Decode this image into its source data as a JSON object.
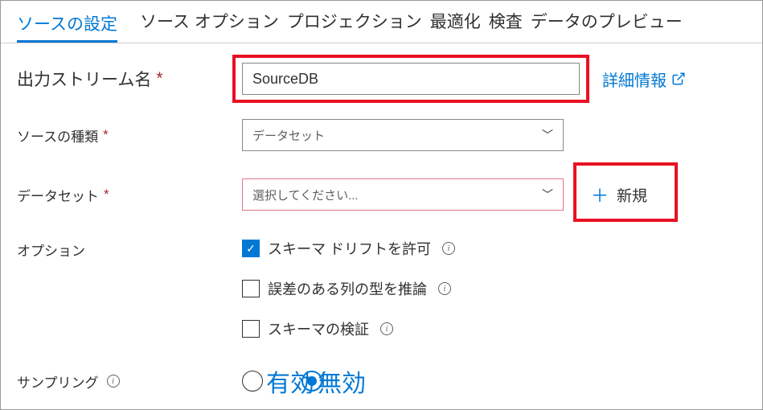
{
  "tabs": {
    "active": "ソースの設定",
    "others": [
      "ソース オプション",
      "プロジェクション",
      "最適化",
      "検査",
      "データのプレビュー"
    ]
  },
  "details_link": "詳細情報",
  "new_button": "新規",
  "form": {
    "output_stream": {
      "label": "出力ストリーム名",
      "value": "SourceDB"
    },
    "source_type": {
      "label": "ソースの種類",
      "selected": "データセット"
    },
    "dataset": {
      "label": "データセット",
      "placeholder": "選択してください..."
    },
    "options_label": "オプション",
    "options": {
      "schema_drift": "スキーマ ドリフトを許可",
      "infer_types": "誤差のある列の型を推論",
      "validate_schema": "スキーマの検証"
    },
    "sampling": {
      "label": "サンプリング",
      "enable": "有効",
      "disable": "無効"
    }
  }
}
